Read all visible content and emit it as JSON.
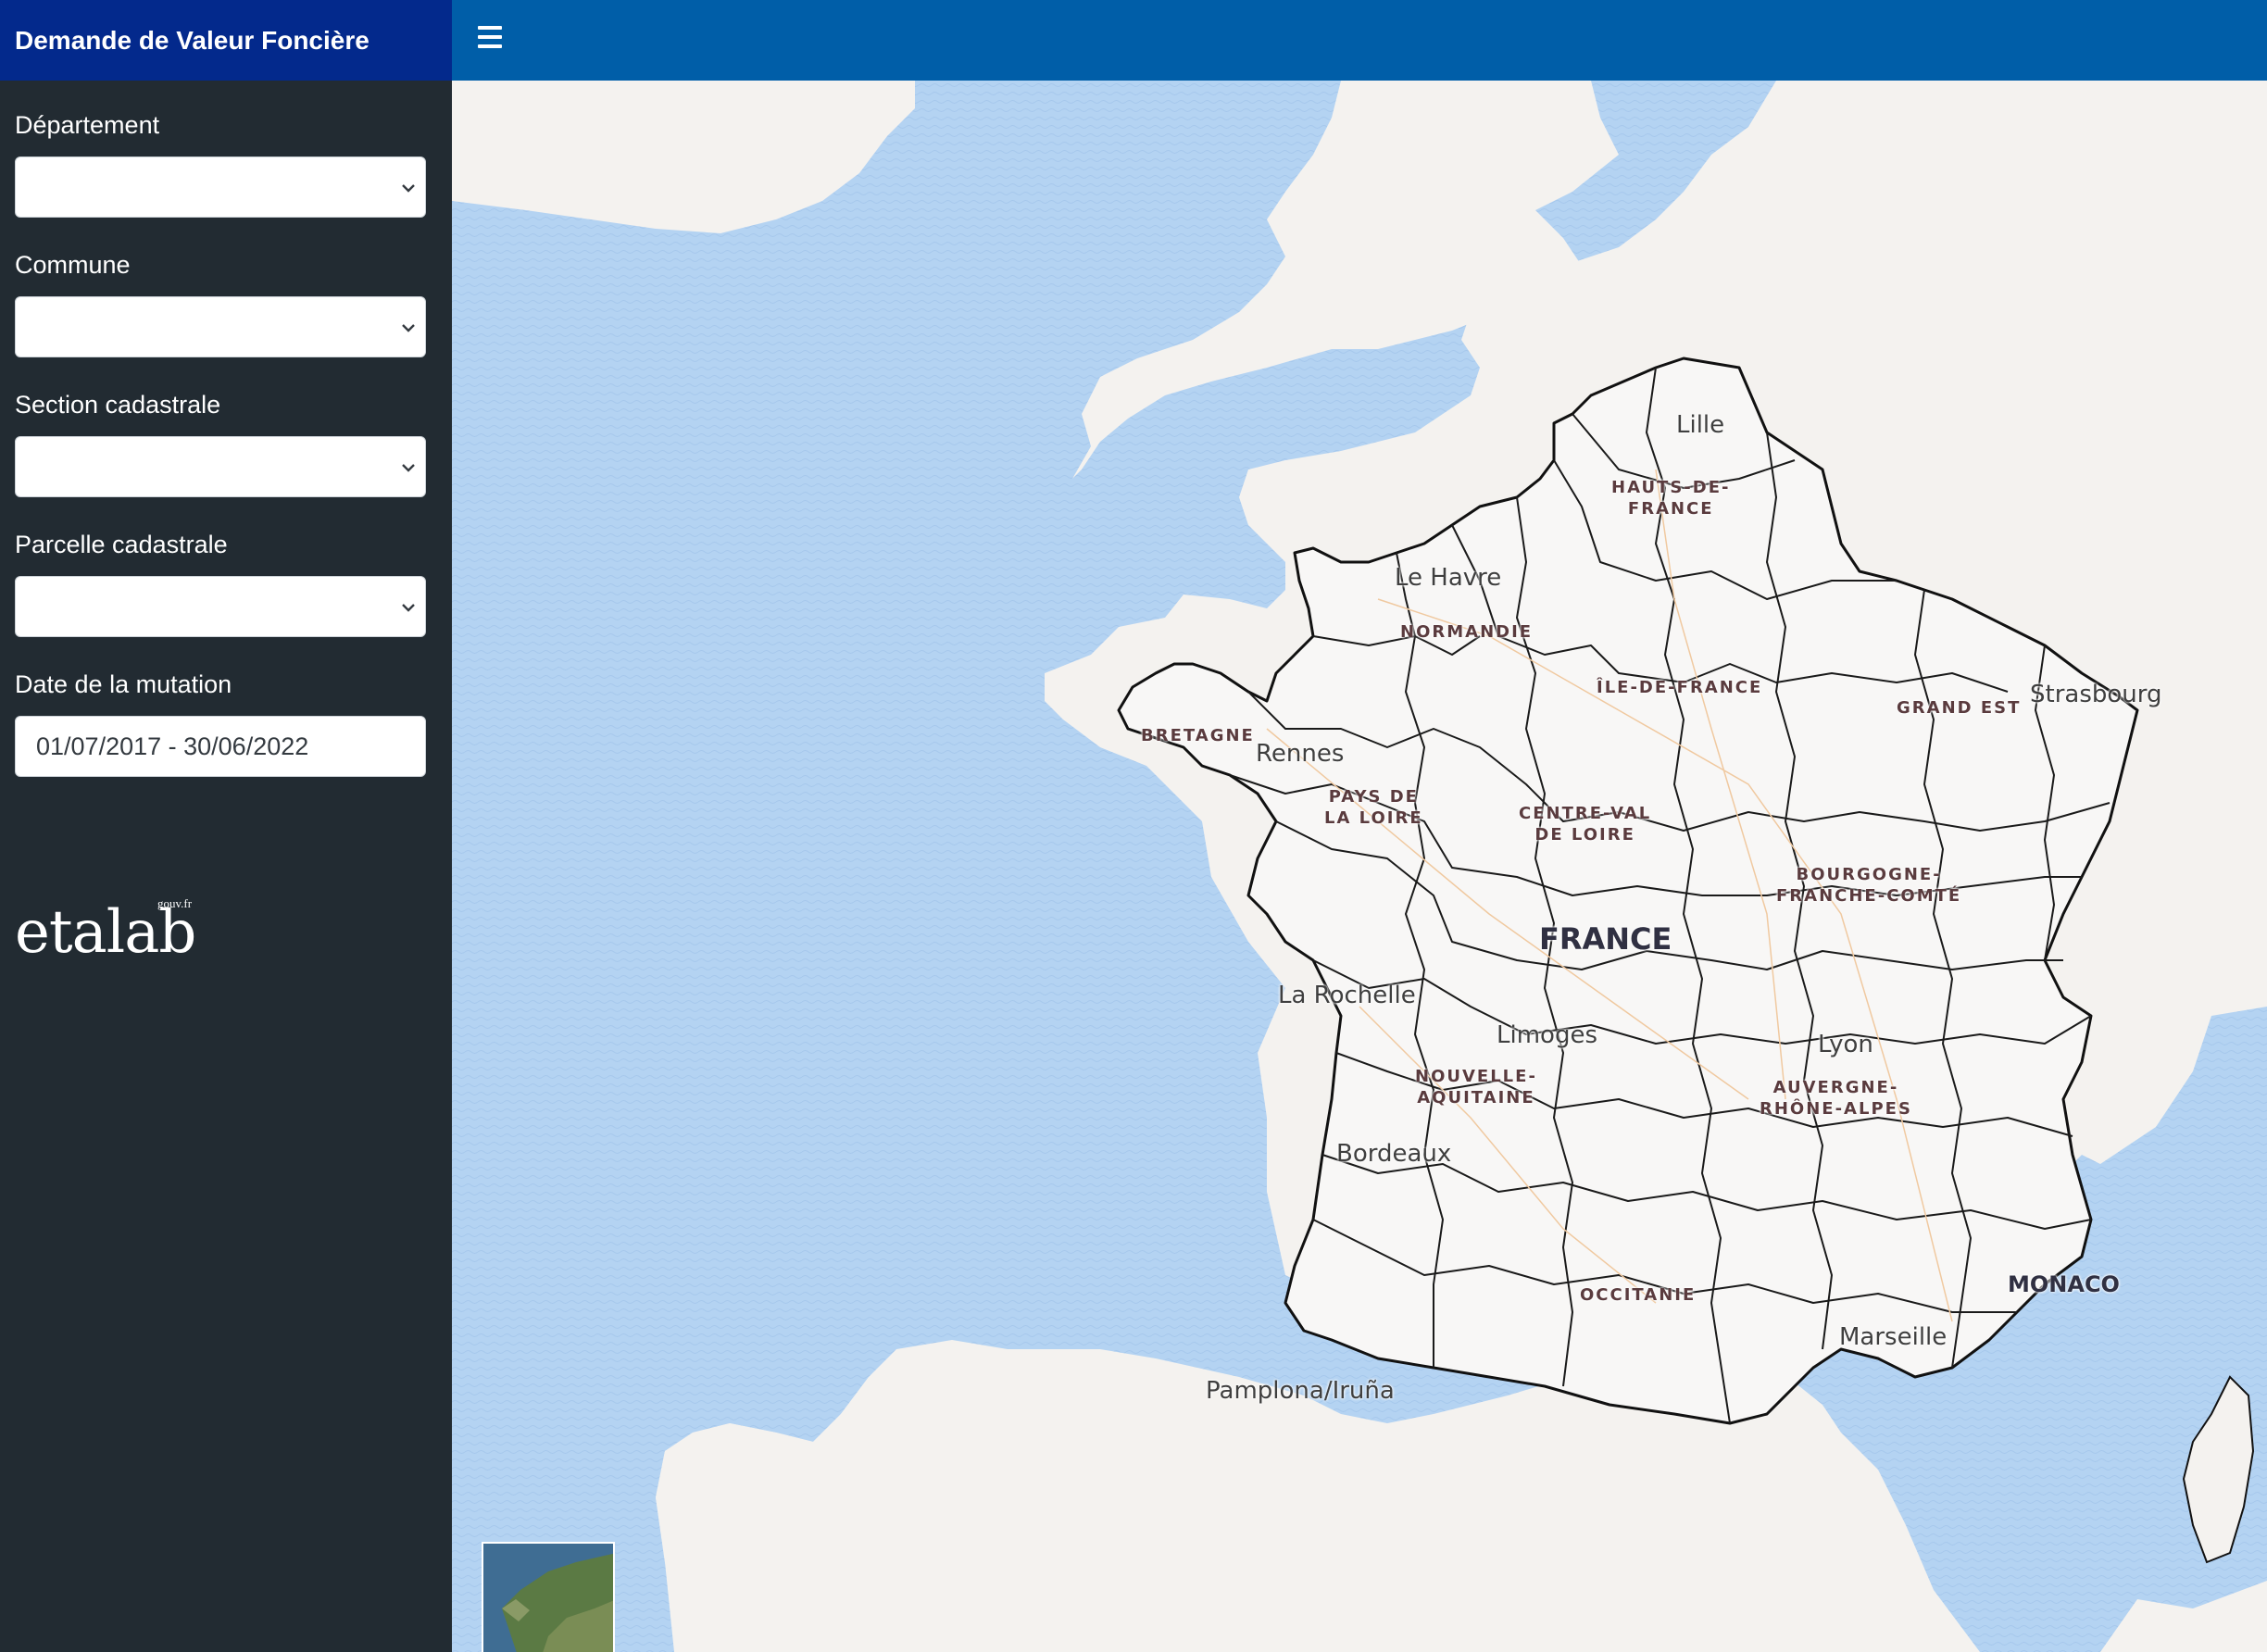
{
  "app": {
    "title": "Demande de Valeur Foncière"
  },
  "filters": {
    "departement": {
      "label": "Département",
      "value": ""
    },
    "commune": {
      "label": "Commune",
      "value": ""
    },
    "section": {
      "label": "Section cadastrale",
      "value": ""
    },
    "parcelle": {
      "label": "Parcelle cadastrale",
      "value": ""
    },
    "date": {
      "label": "Date de la mutation",
      "value": "01/07/2017 - 30/06/2022"
    }
  },
  "logo": {
    "text": "etalab",
    "sup": "gouv.fr"
  },
  "topbar": {
    "menu_icon": "hamburger-menu-icon"
  },
  "map": {
    "country_label": "FRANCE",
    "monaco_label": "MONACO",
    "cities": [
      {
        "name": "Lille"
      },
      {
        "name": "Le Havre"
      },
      {
        "name": "Rennes"
      },
      {
        "name": "Strasbourg"
      },
      {
        "name": "La Rochelle"
      },
      {
        "name": "Limoges"
      },
      {
        "name": "Lyon"
      },
      {
        "name": "Bordeaux"
      },
      {
        "name": "Marseille"
      },
      {
        "name": "Pamplona/Iruña"
      }
    ],
    "regions": [
      {
        "line1": "HAUTS-DE-",
        "line2": "FRANCE"
      },
      {
        "line1": "NORMANDIE",
        "line2": ""
      },
      {
        "line1": "ÎLE-DE-FRANCE",
        "line2": ""
      },
      {
        "line1": "GRAND EST",
        "line2": ""
      },
      {
        "line1": "BRETAGNE",
        "line2": ""
      },
      {
        "line1": "PAYS DE",
        "line2": "LA LOIRE"
      },
      {
        "line1": "CENTRE-VAL",
        "line2": "DE LOIRE"
      },
      {
        "line1": "BOURGOGNE-",
        "line2": "FRANCHE-COMTÉ"
      },
      {
        "line1": "NOUVELLE-",
        "line2": "AQUITAINE"
      },
      {
        "line1": "AUVERGNE-",
        "line2": "RHÔNE-ALPES"
      },
      {
        "line1": "OCCITANIE",
        "line2": ""
      }
    ],
    "colors": {
      "sea": "#b4d3f2",
      "land": "#f4f2ef",
      "border": "#111111"
    }
  }
}
